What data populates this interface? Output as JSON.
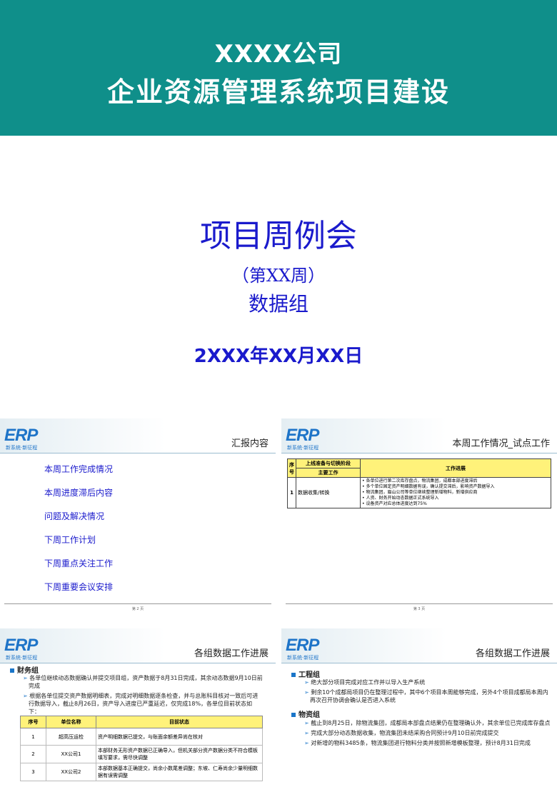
{
  "cover": {
    "company": "XXXX公司",
    "project": "企业资源管理系统项目建设",
    "title": "项目周例会",
    "week": "（第XX周）",
    "group": "数据组",
    "date": "2XXX年XX月XX日"
  },
  "logo": {
    "brand": "ERP",
    "tagline": "新系统·新征程"
  },
  "slide2": {
    "title": "汇报内容",
    "items": [
      "本周工作完成情况",
      "本周进度滞后内容",
      "问题及解决情况",
      "下周工作计划",
      "下周重点关注工作",
      "下周重要会议安排"
    ],
    "page": "第 2 页"
  },
  "slide3": {
    "title": "本周工作情况_试点工作",
    "headers": {
      "seq": "序号",
      "stage": "上线准备与切换阶段",
      "main": "主要工作",
      "progress": "工作进展"
    },
    "row": {
      "seq": "1",
      "work": "数据收集/转换"
    },
    "progress": [
      "• 各单位进行第二次库存盘点，物流集团，成都本部进度滞后",
      "• 多个单位固定资产明细数据有误，确认提交滞后，影响资产数据导入",
      "• 物流集团，眉山公司等单位继续整理新增物料，新增供应商",
      "• 人资、财务开始动态数据正式系统导入",
      "• 设备资产对应总体进度达到75%"
    ],
    "page": "第 3 页"
  },
  "slide4": {
    "title": "各组数据工作进展",
    "section": "财务组",
    "bullets": [
      "各单位继续动态数据确认并提交项目组，资产数据于8月31日完成，其余动态数据9月10日前完成",
      "根据各单位提交资产数据明细表，完成对明细数据逐条检查，并与总账科目核对一致后可进行数据导入，截止8月26日，资产导入进度已严重延迟，仅完成18%，各单位目前状态如下："
    ],
    "table_headers": [
      "序号",
      "单位名称",
      "目前状态"
    ],
    "rows": [
      [
        "1",
        "超高压运检",
        "资产明细数据已提交，与账面余额差异尚在核对"
      ],
      [
        "2",
        "XX公司1",
        "本部财务无形资产数据已正确导入，但机关部分资产数据分类不符合模板填写要求，需尽快调整"
      ],
      [
        "3",
        "XX公司2",
        "本部数据基本正确提交，尚余小数尾差调整；东坡、仁寿尚余少量明细数据有误需调整"
      ]
    ]
  },
  "slide5": {
    "title": "各组数据工作进展",
    "section1": "工程组",
    "bullets1": [
      "绝大部分项目完成对应工作并以导入生产系统",
      "剩余10个成都局项目仍在整理过程中，其中6个项目本周能够完成，另外4个项目成都局本周内再次召开协调会确认是否进入系统"
    ],
    "section2": "物资组",
    "bullets2": [
      "截止到8月25日，除物流集团，成都局本部盘点结果仍在整理确认外，其余单位已完成库存盘点",
      "完成大部分动态数据收集，物流集团未结采购合同预计9月10日前完成提交",
      "对新增的物料3485条，物流集团进行物料分类并按照新增模板整理，预计8月31日完成"
    ]
  },
  "colors": {
    "banner": "#0f8f8a",
    "title_blue": "#1a1acc",
    "table_header": "#fff27a"
  }
}
